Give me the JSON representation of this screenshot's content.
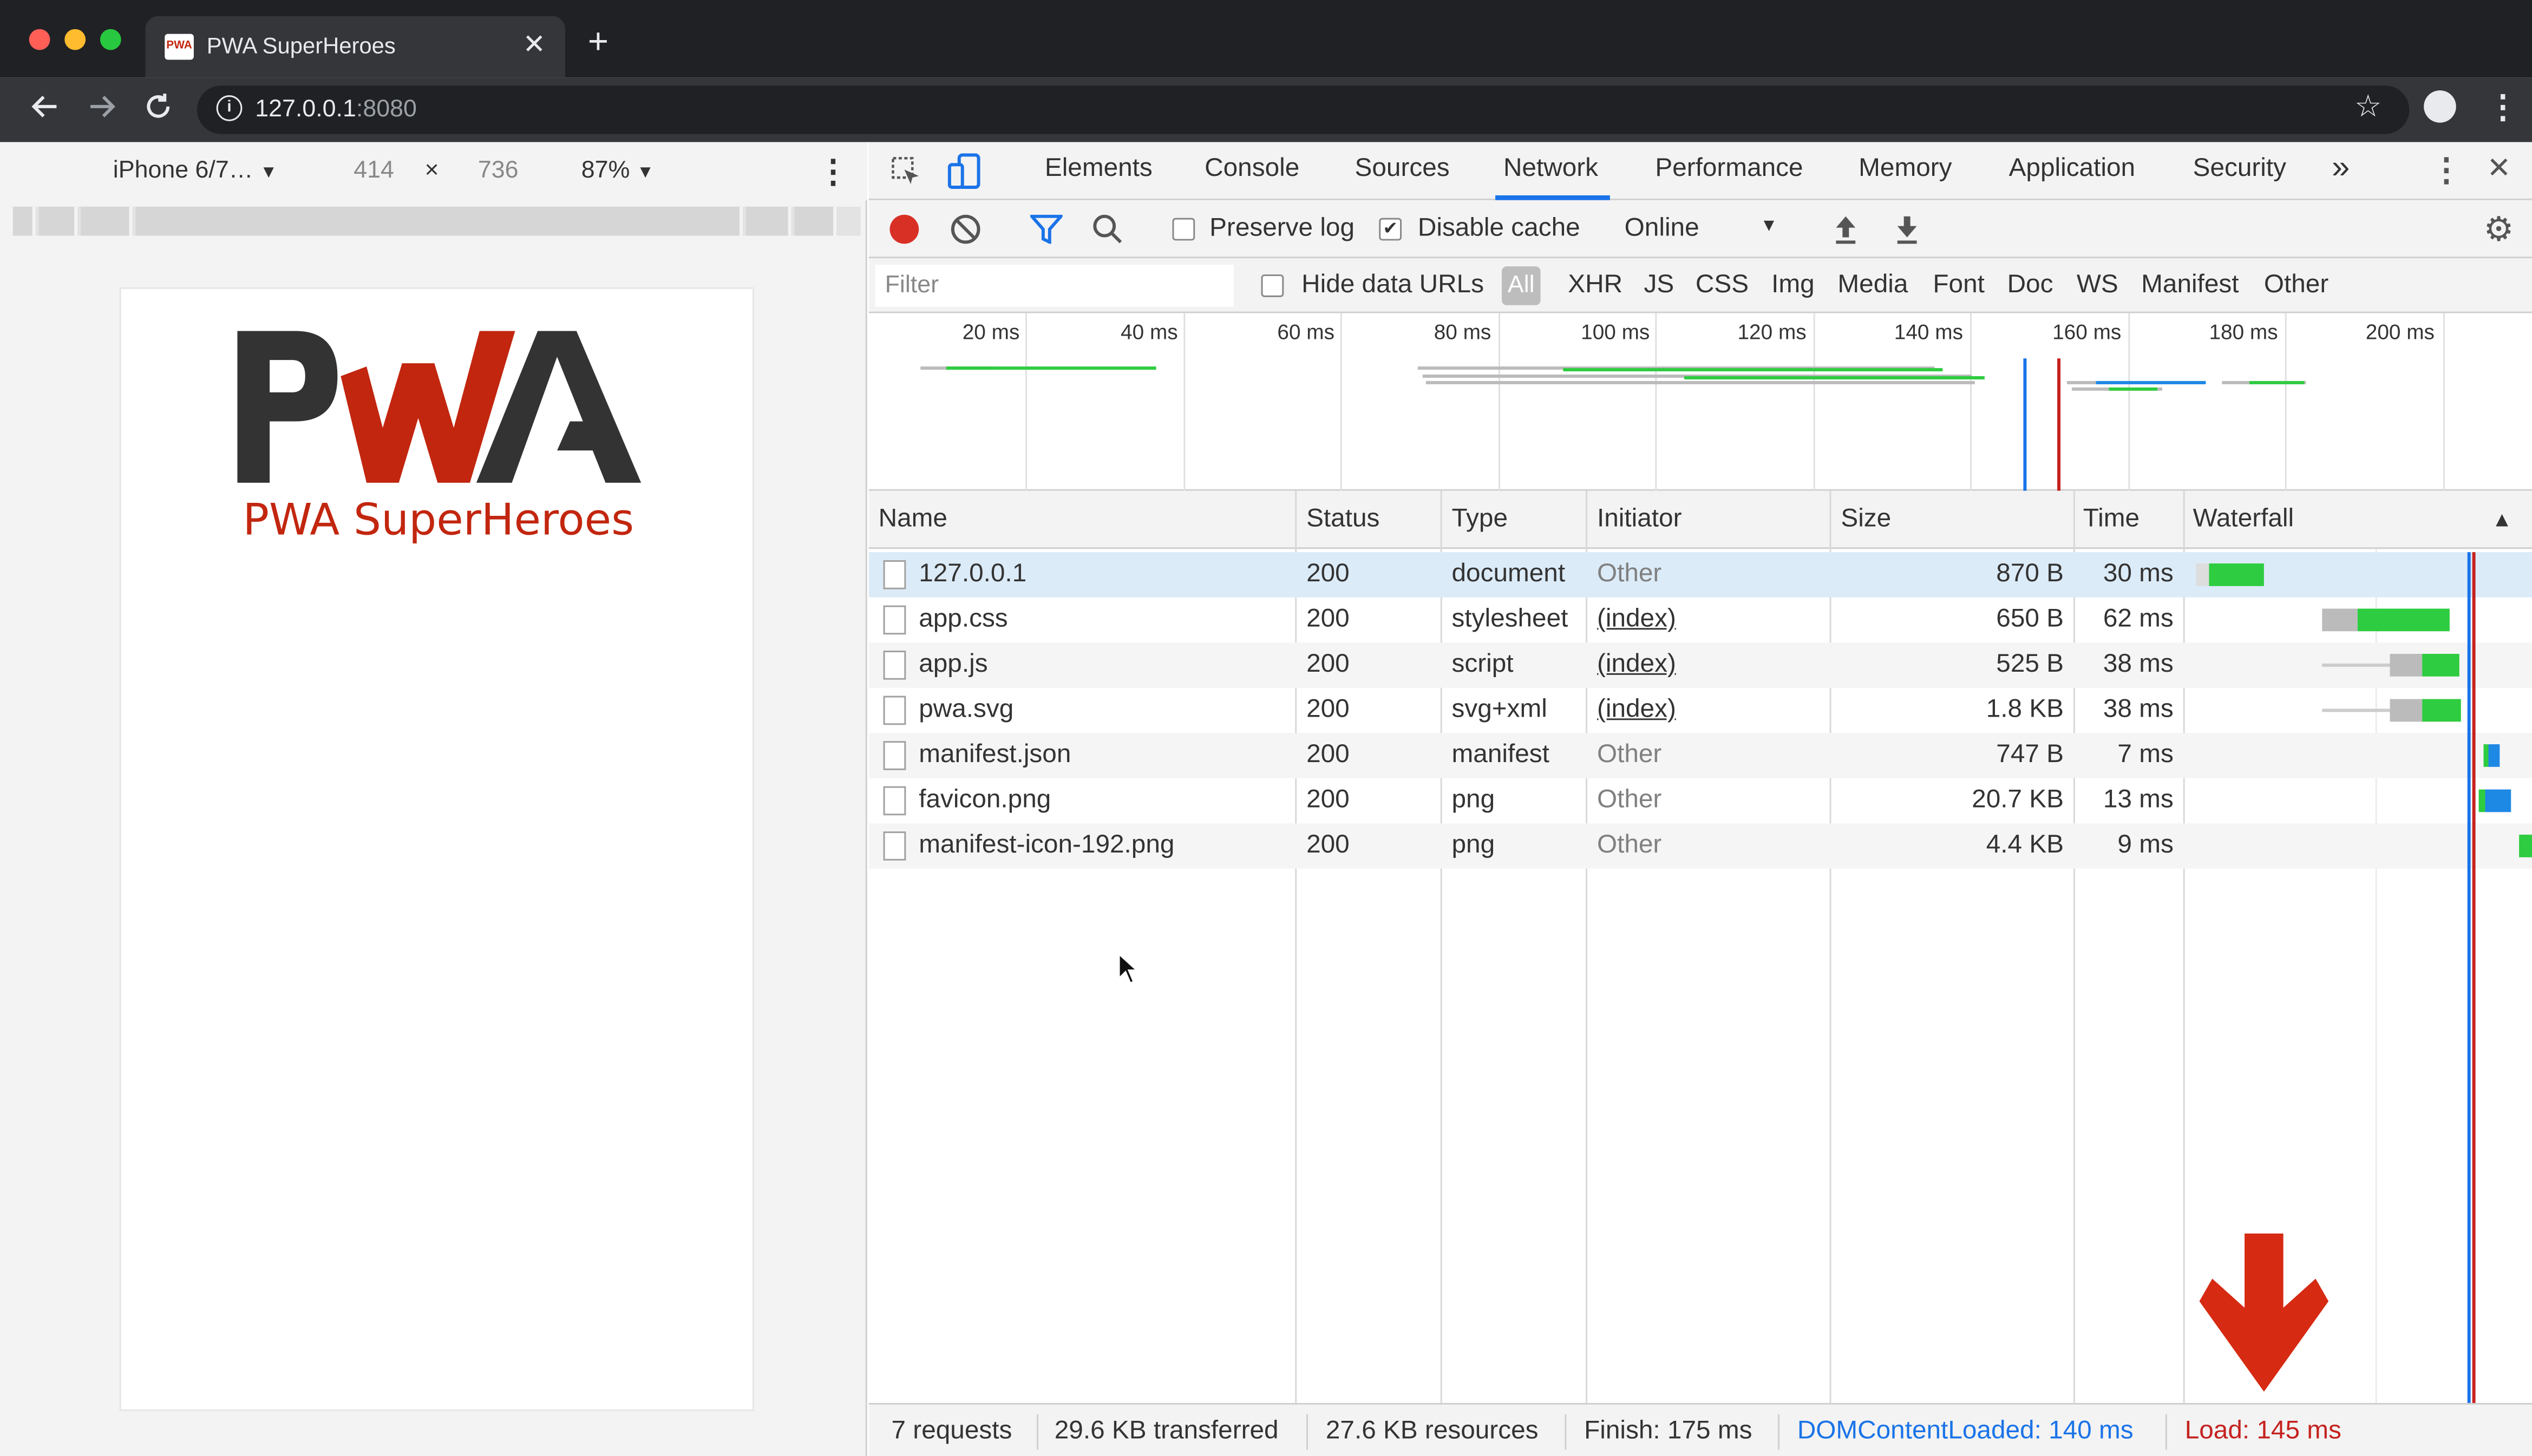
{
  "browser": {
    "tab_title": "PWA SuperHeroes",
    "tab_favicon_text": "PWA",
    "close_glyph": "✕",
    "new_tab_glyph": "+",
    "url_host": "127.0.0.1",
    "url_port": ":8080",
    "icons": [
      "back-icon",
      "forward-icon",
      "reload-icon",
      "info-icon",
      "star-icon",
      "profile-icon",
      "kebab-menu-icon"
    ]
  },
  "device_toolbar": {
    "device": "iPhone 6/7…",
    "width": "414",
    "times": "×",
    "height": "736",
    "zoom": "87%"
  },
  "page": {
    "logo_text": "PWA",
    "title": "PWA SuperHeroes",
    "colors": {
      "logo_dark": "#333333",
      "logo_red": "#c2260f"
    }
  },
  "devtools": {
    "tabs": [
      "Elements",
      "Console",
      "Sources",
      "Network",
      "Performance",
      "Memory",
      "Application",
      "Security"
    ],
    "active_tab": "Network",
    "more_tabs_glyph": "»",
    "controls": {
      "preserve_log": "Preserve log",
      "preserve_log_checked": false,
      "disable_cache": "Disable cache",
      "disable_cache_checked": true,
      "throttling": "Online"
    },
    "filter": {
      "placeholder": "Filter",
      "hide_data_urls": "Hide data URLs",
      "types": [
        "All",
        "XHR",
        "JS",
        "CSS",
        "Img",
        "Media",
        "Font",
        "Doc",
        "WS",
        "Manifest",
        "Other"
      ],
      "active_type": "All"
    },
    "overview_ticks": [
      "20 ms",
      "40 ms",
      "60 ms",
      "80 ms",
      "100 ms",
      "120 ms",
      "140 ms",
      "160 ms",
      "180 ms",
      "200 ms"
    ],
    "table": {
      "columns": [
        "Name",
        "Status",
        "Type",
        "Initiator",
        "Size",
        "Time",
        "Waterfall"
      ],
      "rows": [
        {
          "name": "127.0.0.1",
          "status": "200",
          "type": "document",
          "initiator": "Other",
          "size": "870 B",
          "time": "30 ms"
        },
        {
          "name": "app.css",
          "status": "200",
          "type": "stylesheet",
          "initiator": "(index)",
          "size": "650 B",
          "time": "62 ms"
        },
        {
          "name": "app.js",
          "status": "200",
          "type": "script",
          "initiator": "(index)",
          "size": "525 B",
          "time": "38 ms"
        },
        {
          "name": "pwa.svg",
          "status": "200",
          "type": "svg+xml",
          "initiator": "(index)",
          "size": "1.8 KB",
          "time": "38 ms"
        },
        {
          "name": "manifest.json",
          "status": "200",
          "type": "manifest",
          "initiator": "Other",
          "size": "747 B",
          "time": "7 ms"
        },
        {
          "name": "favicon.png",
          "status": "200",
          "type": "png",
          "initiator": "Other",
          "size": "20.7 KB",
          "time": "13 ms"
        },
        {
          "name": "manifest-icon-192.png",
          "status": "200",
          "type": "png",
          "initiator": "Other",
          "size": "4.4 KB",
          "time": "9 ms"
        }
      ]
    },
    "status_bar": {
      "requests": "7 requests",
      "transferred": "29.6 KB transferred",
      "resources": "27.6 KB resources",
      "finish": "Finish: 175 ms",
      "dom_content_loaded": "DOMContentLoaded: 140 ms",
      "load": "Load: 145 ms"
    },
    "colors": {
      "dcl": "#1a73e8",
      "load": "#c5221f",
      "bar_green": "#2ecc40",
      "bar_blue": "#1e88e5",
      "annotation_arrow": "#d62a12"
    }
  }
}
